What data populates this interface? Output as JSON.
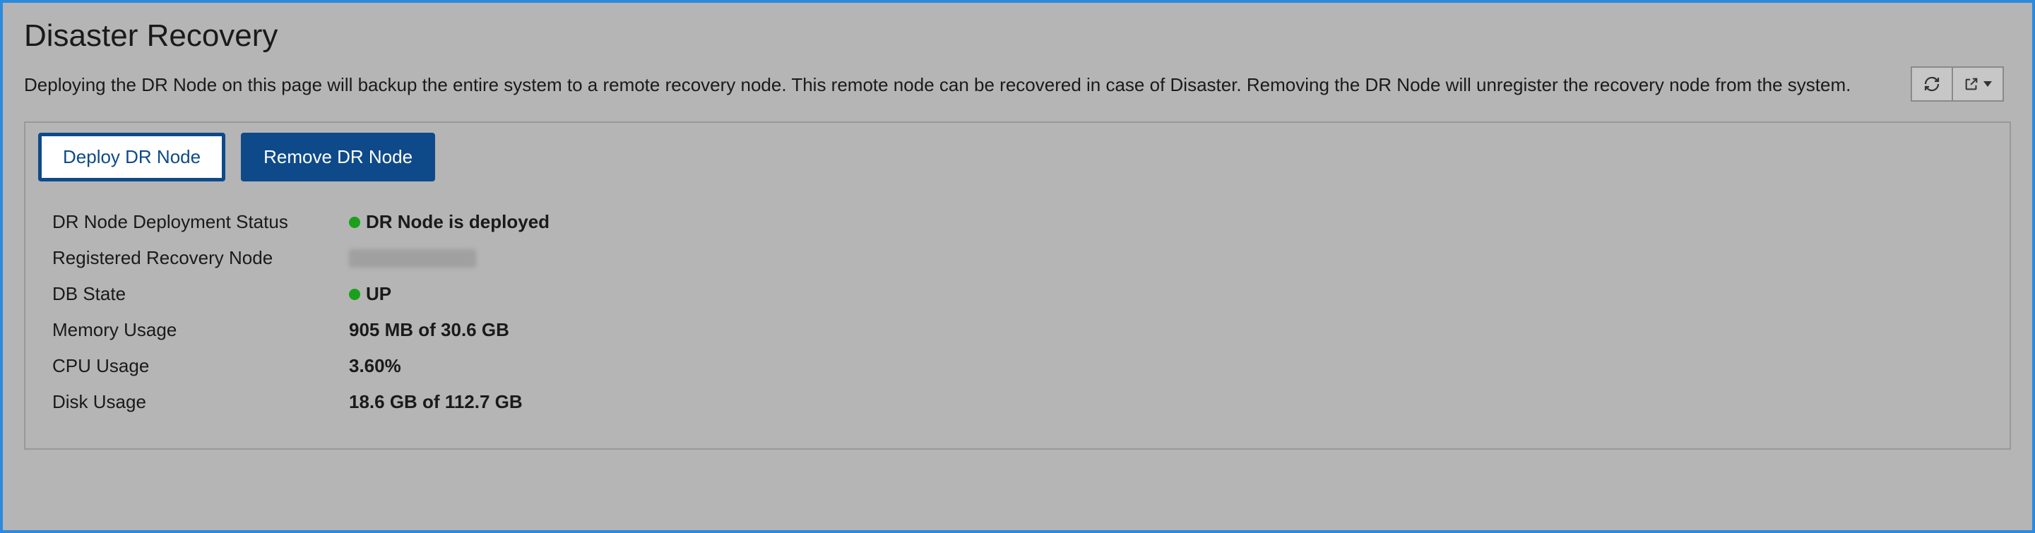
{
  "header": {
    "title": "Disaster Recovery",
    "description": "Deploying the DR Node on this page will backup the entire system to a remote recovery node. This remote node can be recovered in case of Disaster. Removing the DR Node will unregister the recovery node from the system."
  },
  "toolbar": {
    "refresh_icon": "refresh",
    "external_icon": "open-external"
  },
  "actions": {
    "deploy_label": "Deploy DR Node",
    "remove_label": "Remove DR Node"
  },
  "status": {
    "deployment": {
      "label": "DR Node Deployment Status",
      "value": "DR Node is deployed",
      "dot_color": "green"
    },
    "recovery_node": {
      "label": "Registered Recovery Node",
      "value": ""
    },
    "db_state": {
      "label": "DB State",
      "value": "UP",
      "dot_color": "green"
    },
    "memory": {
      "label": "Memory Usage",
      "value": "905 MB of 30.6 GB"
    },
    "cpu": {
      "label": "CPU Usage",
      "value": "3.60%"
    },
    "disk": {
      "label": "Disk Usage",
      "value": "18.6 GB of 112.7 GB"
    }
  }
}
